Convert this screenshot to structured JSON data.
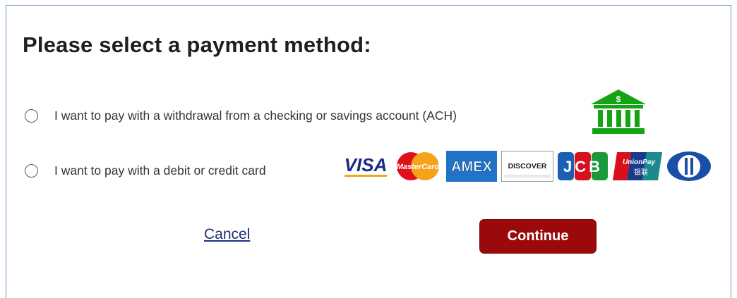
{
  "title": "Please select a payment method:",
  "options": {
    "ach": {
      "label": "I want to pay with a withdrawal from a checking or savings account (ACH)",
      "selected": false
    },
    "card": {
      "label": "I want to pay with a debit or credit card",
      "selected": false
    }
  },
  "bank_icon": {
    "name": "bank-icon",
    "symbol": "$",
    "color": "#15a315"
  },
  "card_logos": {
    "visa": "VISA",
    "mastercard": "MasterCard",
    "amex": "AMEX",
    "discover": "DISCOVER",
    "jcb": "JCB",
    "unionpay": "UnionPay",
    "unionpay_sub": "银联"
  },
  "actions": {
    "cancel_label": "Cancel",
    "continue_label": "Continue"
  },
  "colors": {
    "border": "#6e93c9",
    "continue_bg": "#9b0a0a",
    "link": "#1f2f7a"
  }
}
